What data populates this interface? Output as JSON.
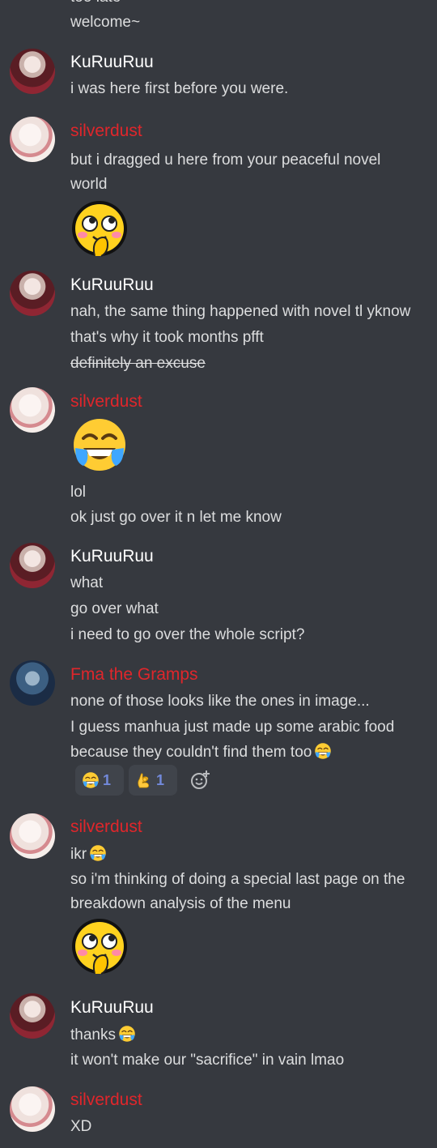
{
  "messages": {
    "top": {
      "cut_line": "too late",
      "line1": "welcome~"
    },
    "m1": {
      "author": "KuRuuRuu",
      "line1": "i was here first before you were."
    },
    "m2": {
      "author": "silverdust",
      "line1": "but i dragged u here from your peaceful novel",
      "line2": "world",
      "emoji": "smug-blush-emoji"
    },
    "m3": {
      "author": "KuRuuRuu",
      "line1": "nah, the same thing happened with novel tl yknow",
      "line2": "that's why it took months pfft",
      "line3_strikethrough": "definitely an excuse"
    },
    "m4": {
      "author": "silverdust",
      "emoji": "tears-of-joy-emoji",
      "line1": "lol",
      "line2": "ok just go over it n let me know"
    },
    "m5": {
      "author": "KuRuuRuu",
      "line1": "what",
      "line2": "go over what",
      "line3": "i need to go over the whole script?"
    },
    "m6": {
      "author": "Fma the Gramps",
      "line1": "none of those looks like the ones in image...",
      "line2": "I guess manhua just made up some arabic food",
      "line3": "because they couldn't find them too",
      "reactions": [
        {
          "emoji": "tears-of-joy-emoji",
          "count": "1"
        },
        {
          "emoji": "ok-hand-emoji",
          "count": "1"
        }
      ]
    },
    "m7": {
      "author": "silverdust",
      "line1": "ikr",
      "line2": "so i'm thinking of doing a special last page on the",
      "line3": "breakdown analysis of the menu",
      "emoji": "smug-blush-emoji"
    },
    "m8": {
      "author": "KuRuuRuu",
      "line1": "thanks",
      "line2": "it won't make our \"sacrifice\" in vain lmao"
    },
    "m9": {
      "author": "silverdust",
      "line1": "XD"
    }
  },
  "colors": {
    "background": "#36393f",
    "text": "#dcddde",
    "author_white": "#ffffff",
    "author_red": "#e0262b",
    "reaction_bg": "#40444b",
    "reaction_count": "#7289da"
  }
}
